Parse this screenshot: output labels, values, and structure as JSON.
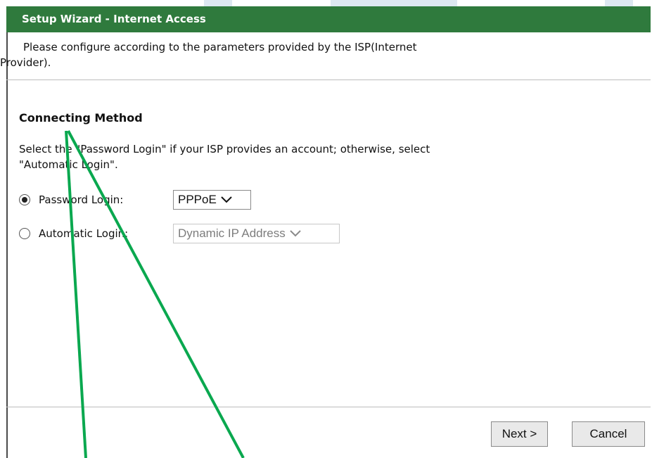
{
  "wizard": {
    "title": "Setup Wizard - Internet Access",
    "intro_line1": "Please configure according to the parameters provided by the ISP(Internet",
    "intro_line2": "Provider).",
    "section_title": "Connecting Method",
    "description_line1": "Select the \"Password Login\" if your ISP provides an account; otherwise, select",
    "description_line2": "\"Automatic Login\"."
  },
  "options": {
    "password_login": {
      "label": "Password Login:",
      "checked": true,
      "select_value": "PPPoE"
    },
    "automatic_login": {
      "label": "Automatic Login:",
      "checked": false,
      "select_value": "Dynamic IP Address",
      "disabled": true
    }
  },
  "buttons": {
    "next": "Next >",
    "cancel": "Cancel"
  },
  "colors": {
    "header_bg": "#2f7a3d",
    "annotation_arrow": "#0aa84f"
  },
  "icons": {
    "dropdown": "chevron-down-icon",
    "radio_selected": "radio-checked-icon",
    "radio_unselected": "radio-unchecked-icon"
  }
}
